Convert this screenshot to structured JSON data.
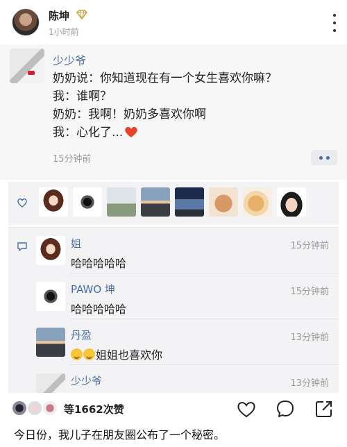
{
  "header": {
    "author_name": "陈坤",
    "post_time": "1小时前"
  },
  "post": {
    "author": "少少爷",
    "lines": [
      "奶奶说：你知道现在有一个女生喜欢你嘛？",
      "我：谁啊？",
      "奶奶：我啊！奶奶多喜欢你啊",
      "我：心化了..."
    ],
    "emoji": "red-heart-emoji",
    "time": "15分钟前"
  },
  "likes": {
    "avatars": [
      "cartoon-girl",
      "ink-figure",
      "rainbow-landscape",
      "couple-sunset",
      "blue-sky",
      "fluffy-character",
      "dog-photo",
      "bob-hair-cartoon"
    ]
  },
  "comments": [
    {
      "name": "姐",
      "time": "15分钟前",
      "text": "哈哈哈哈哈"
    },
    {
      "name": "PAWO 坤",
      "time": "15分钟前",
      "text": "哈哈哈哈哈"
    },
    {
      "name": "丹盈",
      "time": "13分钟前",
      "text": "姐姐也喜欢你",
      "emoji": "grin-emoji"
    },
    {
      "name": "少少爷",
      "time": "13分钟前",
      "text": ""
    }
  ],
  "bottom": {
    "likes_count": "等1662次赞",
    "caption": "今日份，我儿子在朋友圈公布了一个秘密。"
  },
  "colors": {
    "name_blue": "#4a6fa5",
    "timestamp_gray": "#999999",
    "panel_gray": "#f3f3f5",
    "heart_red": "#e8412c"
  }
}
